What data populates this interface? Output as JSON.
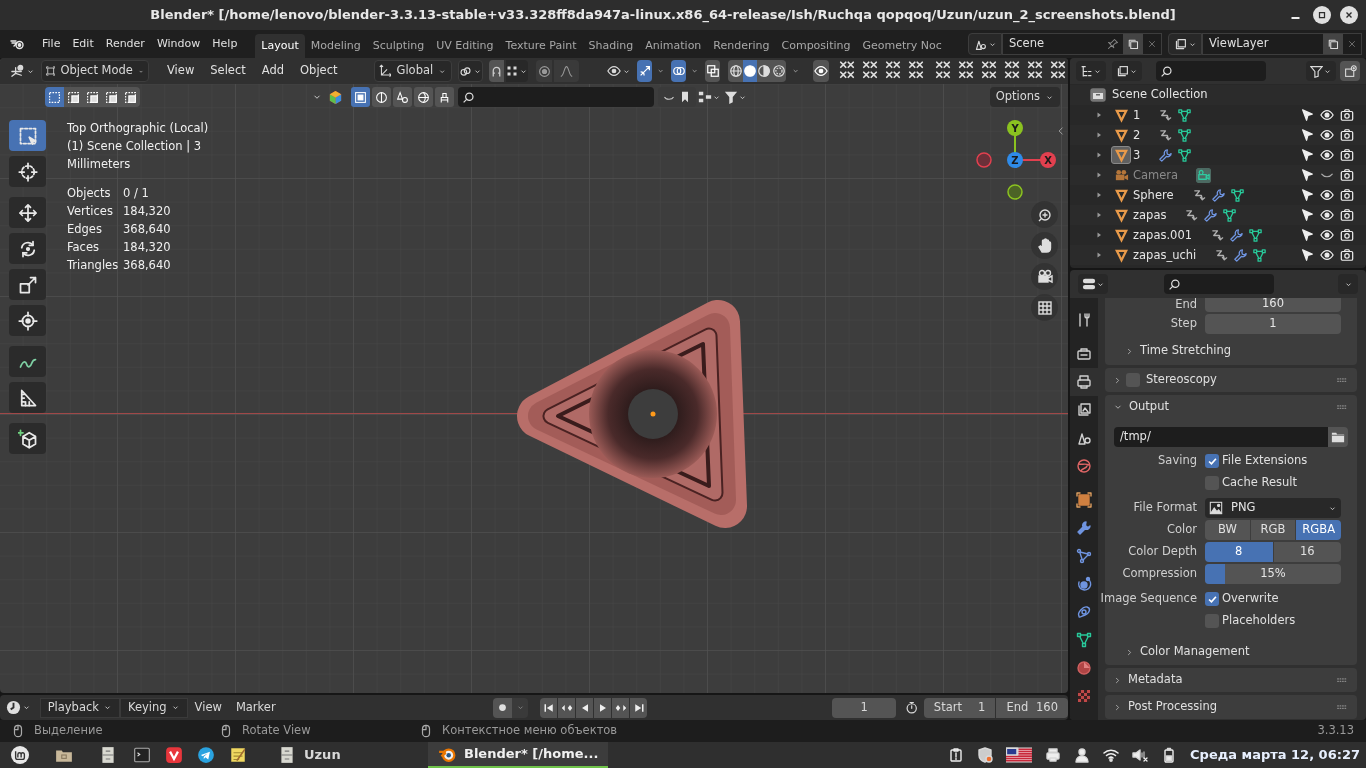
{
  "window": {
    "title": "Blender* [/home/lenovo/blender-3.3.13-stable+v33.328ff8da947a-linux.x86_64-release/Ish/Ruchqa qopqoq/Uzun/uzun_2_screenshots.blend]"
  },
  "menu": [
    "File",
    "Edit",
    "Render",
    "Window",
    "Help"
  ],
  "workspaces": [
    {
      "label": "Layout",
      "selected": true
    },
    {
      "label": "Modeling",
      "selected": false
    },
    {
      "label": "Sculpting",
      "selected": false
    },
    {
      "label": "UV Editing",
      "selected": false
    },
    {
      "label": "Texture Paint",
      "selected": false
    },
    {
      "label": "Shading",
      "selected": false
    },
    {
      "label": "Animation",
      "selected": false
    },
    {
      "label": "Rendering",
      "selected": false
    },
    {
      "label": "Compositing",
      "selected": false
    },
    {
      "label": "Geometry Noc",
      "selected": false
    }
  ],
  "scene": "Scene",
  "view_layer": "ViewLayer",
  "viewport_header": {
    "mode": "Object Mode",
    "menus": [
      "View",
      "Select",
      "Add",
      "Object"
    ],
    "orientation": "Global",
    "gizmos_on": true,
    "overlays_on": true,
    "xray_on": false,
    "shading": [
      {
        "kind": "wireframe",
        "selected": false
      },
      {
        "kind": "solid",
        "selected": true
      },
      {
        "kind": "material",
        "selected": false
      },
      {
        "kind": "rendered",
        "selected": false
      }
    ],
    "options": "Options"
  },
  "select_modes": [
    {
      "selected": true
    },
    {
      "selected": false
    },
    {
      "selected": false
    },
    {
      "selected": false
    },
    {
      "selected": false
    }
  ],
  "tools": [
    {
      "kind": "select_box",
      "selected": true
    },
    {
      "kind": "cursor",
      "selected": false
    },
    {
      "kind": "move",
      "selected": false
    },
    {
      "kind": "rotate",
      "selected": false
    },
    {
      "kind": "scale",
      "selected": false
    },
    {
      "kind": "transform",
      "selected": false
    },
    {
      "kind": "annotate",
      "selected": false
    },
    {
      "kind": "measure",
      "selected": false
    },
    {
      "kind": "add_cube",
      "selected": false
    }
  ],
  "viewport_info": {
    "lines": [
      "Top Orthographic (Local)",
      "(1) Scene Collection | 3",
      "Millimeters"
    ],
    "stats": [
      {
        "label": "Objects",
        "value": "0 / 1"
      },
      {
        "label": "Vertices",
        "value": "184,320"
      },
      {
        "label": "Edges",
        "value": "368,640"
      },
      {
        "label": "Faces",
        "value": "184,320"
      },
      {
        "label": "Triangles",
        "value": "368,640"
      }
    ]
  },
  "gizmo_axes": [
    {
      "label": "Y",
      "color": "#8bc220"
    },
    {
      "label": "Z",
      "color": "#2f8be8"
    },
    {
      "label": "X",
      "color": "#e2404f"
    }
  ],
  "outliner": {
    "root": "Scene Collection",
    "items": [
      {
        "name": "1",
        "kind": "mesh",
        "active": false,
        "hidden": false,
        "data_icons": [
          {
            "kind": "constraint"
          },
          {
            "kind": "mesh"
          }
        ]
      },
      {
        "name": "2",
        "kind": "mesh",
        "active": false,
        "hidden": false,
        "data_icons": [
          {
            "kind": "constraint"
          },
          {
            "kind": "mesh"
          }
        ]
      },
      {
        "name": "3",
        "kind": "mesh",
        "active": true,
        "hidden": false,
        "data_icons": [
          {
            "kind": "modifier"
          },
          {
            "kind": "mesh"
          }
        ]
      },
      {
        "name": "Camera",
        "kind": "camera",
        "active": false,
        "hidden": true,
        "data_icons": [
          {
            "kind": "camera_data"
          }
        ]
      },
      {
        "name": "Sphere",
        "kind": "mesh",
        "active": false,
        "hidden": false,
        "data_icons": [
          {
            "kind": "constraint"
          },
          {
            "kind": "modifier"
          },
          {
            "kind": "mesh"
          }
        ]
      },
      {
        "name": "zapas",
        "kind": "mesh",
        "active": false,
        "hidden": false,
        "data_icons": [
          {
            "kind": "constraint"
          },
          {
            "kind": "modifier"
          },
          {
            "kind": "mesh"
          }
        ]
      },
      {
        "name": "zapas.001",
        "kind": "mesh",
        "active": false,
        "hidden": false,
        "data_icons": [
          {
            "kind": "constraint"
          },
          {
            "kind": "modifier"
          },
          {
            "kind": "mesh"
          }
        ]
      },
      {
        "name": "zapas_uchi",
        "kind": "mesh",
        "active": false,
        "hidden": false,
        "data_icons": [
          {
            "kind": "constraint"
          },
          {
            "kind": "modifier"
          },
          {
            "kind": "mesh"
          }
        ]
      }
    ]
  },
  "property_tabs": [
    {
      "kind": "tool",
      "selected": false
    },
    {
      "kind": "render",
      "selected": false
    },
    {
      "kind": "output",
      "selected": true
    },
    {
      "kind": "view_layer",
      "selected": false
    },
    {
      "kind": "scene",
      "selected": false
    },
    {
      "kind": "world",
      "selected": false
    },
    {
      "kind": "object",
      "selected": false
    },
    {
      "kind": "modifier",
      "selected": false
    },
    {
      "kind": "particles",
      "selected": false
    },
    {
      "kind": "physics",
      "selected": false
    },
    {
      "kind": "constraints",
      "selected": false
    },
    {
      "kind": "data",
      "selected": false
    },
    {
      "kind": "material",
      "selected": false
    },
    {
      "kind": "texture",
      "selected": false
    }
  ],
  "properties": {
    "frame_rows": [
      {
        "label": "End",
        "value": "160"
      },
      {
        "label": "Step",
        "value": "1"
      }
    ],
    "time_stretching": "Time Stretching",
    "stereoscopy": {
      "label": "Stereoscopy",
      "checked": false
    },
    "output": {
      "title": "Output",
      "path": "/tmp/",
      "saving": {
        "label": "Saving",
        "options": [
          {
            "label": "File Extensions",
            "checked": true
          },
          {
            "label": "Cache Result",
            "checked": false
          }
        ]
      },
      "file_format": {
        "label": "File Format",
        "value": "PNG"
      },
      "color": {
        "label": "Color",
        "options": [
          {
            "label": "BW",
            "selected": false
          },
          {
            "label": "RGB",
            "selected": false
          },
          {
            "label": "RGBA",
            "selected": true
          }
        ]
      },
      "color_depth": {
        "label": "Color Depth",
        "options": [
          {
            "label": "8",
            "selected": true
          },
          {
            "label": "16",
            "selected": false
          }
        ]
      },
      "compression": {
        "label": "Compression",
        "value": "15%",
        "level": 0.15
      },
      "image_sequence": {
        "label": "Image Sequence",
        "options": [
          {
            "label": "Overwrite",
            "checked": true
          },
          {
            "label": "Placeholders",
            "checked": false
          }
        ]
      },
      "color_management": "Color Management"
    },
    "panels": [
      "Metadata",
      "Post Processing"
    ]
  },
  "timeline": {
    "menus": [
      {
        "label": "Playback",
        "dropdown": true
      },
      {
        "label": "Keying",
        "dropdown": true
      },
      {
        "label": "View",
        "dropdown": false
      },
      {
        "label": "Marker",
        "dropdown": false
      }
    ],
    "current_frame": "1",
    "start_label": "Start",
    "start": "1",
    "end_label": "End",
    "end": "160"
  },
  "status_bar": {
    "hints": [
      "Выделение",
      "Rotate View",
      "Контекстное меню объектов"
    ],
    "version": "3.3.13"
  },
  "taskbar": {
    "windows": [
      {
        "label": "Uzun",
        "kind": "files",
        "selected": false
      },
      {
        "label": "Blender* [/home...",
        "kind": "blender",
        "selected": true
      }
    ],
    "clock": "Среда марта 12, 06:27"
  }
}
